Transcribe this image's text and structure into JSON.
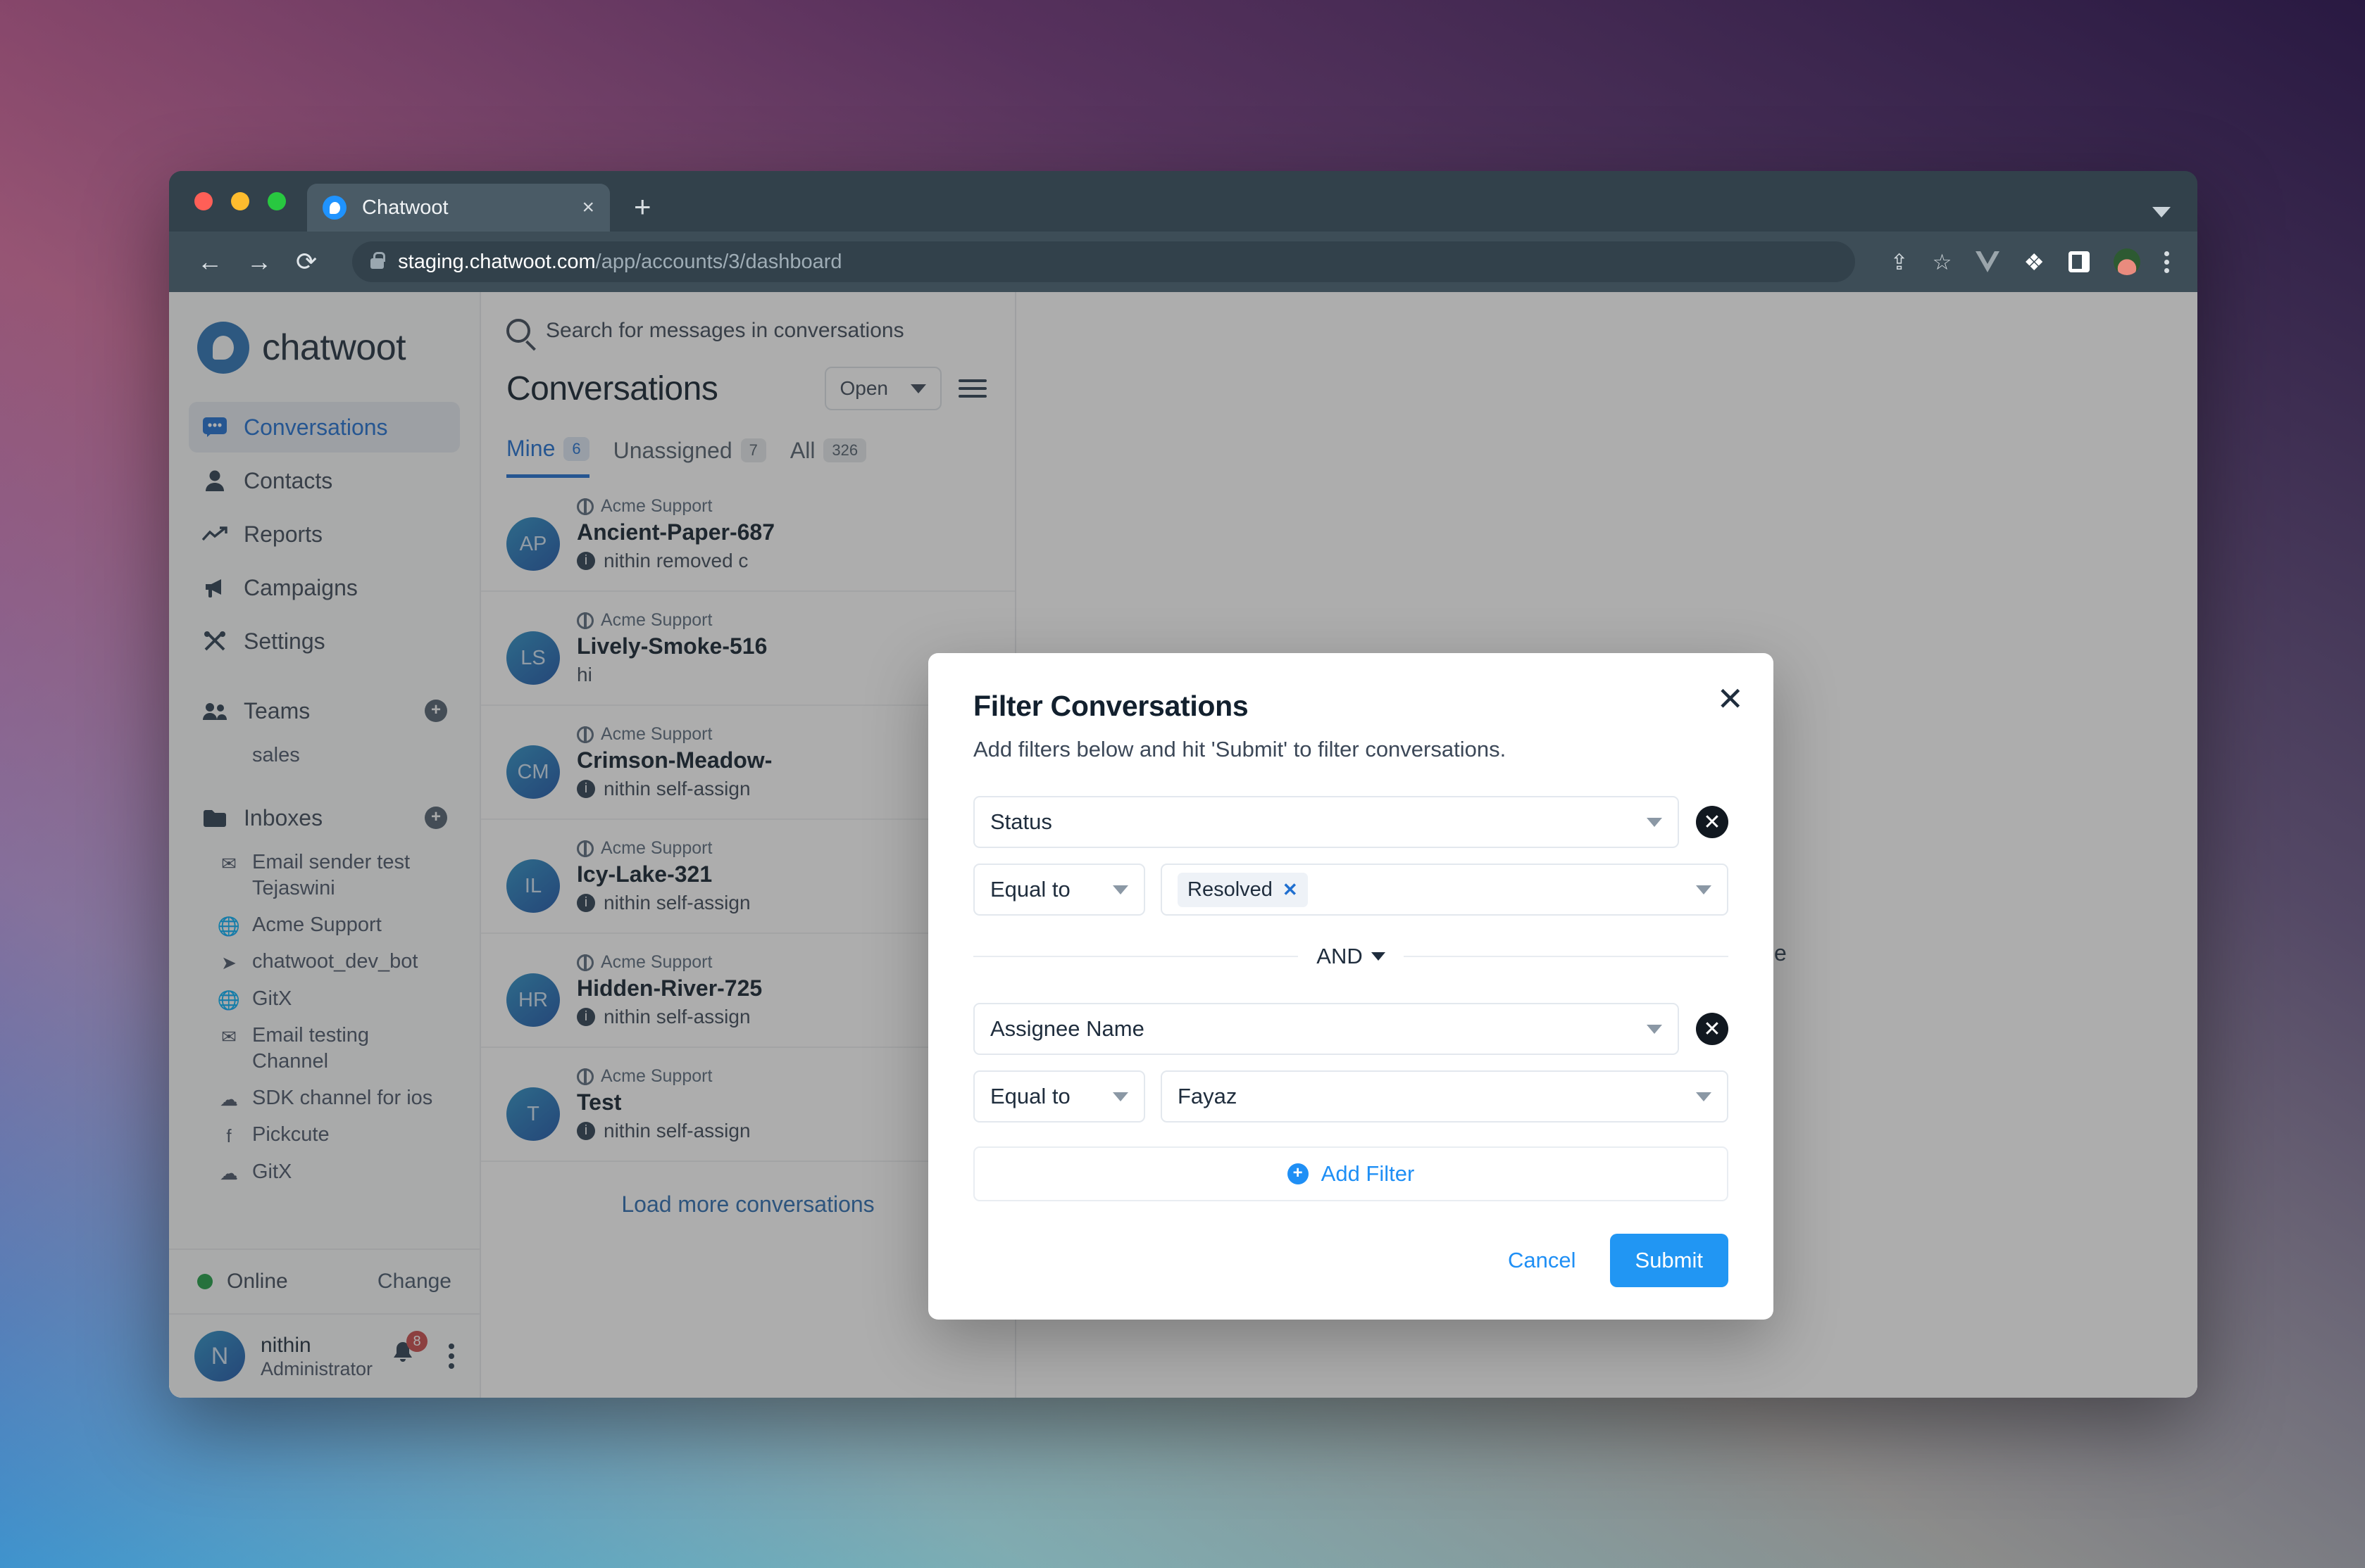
{
  "browser": {
    "tab": {
      "title": "Chatwoot",
      "close_label": "×",
      "favicon_name": "chatwoot-favicon"
    },
    "new_tab_label": "+",
    "url_host": "staging.chatwoot.com",
    "url_path": "/app/accounts/3/dashboard",
    "back_label": "←",
    "forward_label": "→",
    "reload_label": "⟳",
    "share_label": "⇪",
    "bookmark_label": "☆",
    "extensions_label": "❖",
    "menu_label": "kebab"
  },
  "sidebar": {
    "logo_text": "chatwoot",
    "nav": [
      {
        "label": "Conversations",
        "icon": "chat-bubble-icon",
        "glyph": "💬",
        "active": true
      },
      {
        "label": "Contacts",
        "icon": "person-icon",
        "glyph": "👤",
        "active": false
      },
      {
        "label": "Reports",
        "icon": "trending-up-icon",
        "glyph": "↗",
        "active": false
      },
      {
        "label": "Campaigns",
        "icon": "megaphone-icon",
        "glyph": "📣",
        "active": false
      },
      {
        "label": "Settings",
        "icon": "tools-icon",
        "glyph": "⚒",
        "active": false
      }
    ],
    "teams": {
      "label": "Teams",
      "icon": "people-icon",
      "glyph": "👥",
      "add_label": "+",
      "items": [
        {
          "label": "sales"
        }
      ]
    },
    "inboxes": {
      "label": "Inboxes",
      "icon": "folder-icon",
      "glyph": "🗀",
      "add_label": "+",
      "items": [
        {
          "label": "Email sender test Tejaswini",
          "icon": "envelope-icon",
          "glyph": "✉"
        },
        {
          "label": "Acme Support",
          "icon": "globe-icon",
          "glyph": "🌐"
        },
        {
          "label": "chatwoot_dev_bot",
          "icon": "telegram-icon",
          "glyph": "➤"
        },
        {
          "label": "GitX",
          "icon": "globe-icon",
          "glyph": "🌐"
        },
        {
          "label": "Email testing Channel",
          "icon": "envelope-icon",
          "glyph": "✉"
        },
        {
          "label": "SDK channel for ios",
          "icon": "cloud-icon",
          "glyph": "☁"
        },
        {
          "label": "Pickcute",
          "icon": "facebook-icon",
          "glyph": "f"
        },
        {
          "label": "GitX",
          "icon": "cloud-icon",
          "glyph": "☁"
        }
      ]
    },
    "status": {
      "label": "Online",
      "change_label": "Change",
      "color": "#1f9d45"
    },
    "profile": {
      "initial": "N",
      "name": "nithin",
      "role": "Administrator",
      "notification_count": "8",
      "bell_icon": "bell-icon",
      "menu_icon": "kebab-icon"
    }
  },
  "conversations": {
    "search_placeholder": "Search for messages in conversations",
    "title": "Conversations",
    "status_filter": "Open",
    "filter_icon": "sliders-icon",
    "tabs": [
      {
        "label": "Mine",
        "count": "6",
        "active": true
      },
      {
        "label": "Unassigned",
        "count": "7",
        "active": false
      },
      {
        "label": "All",
        "count": "326",
        "active": false
      }
    ],
    "items": [
      {
        "initials": "AP",
        "inbox": "Acme Support",
        "name": "Ancient-Paper-687",
        "message": "nithin removed c"
      },
      {
        "initials": "LS",
        "inbox": "Acme Support",
        "name": "Lively-Smoke-516",
        "message": "hi"
      },
      {
        "initials": "CM",
        "inbox": "Acme Support",
        "name": "Crimson-Meadow-",
        "message": "nithin self-assign"
      },
      {
        "initials": "IL",
        "inbox": "Acme Support",
        "name": "Icy-Lake-321",
        "message": "nithin self-assign"
      },
      {
        "initials": "HR",
        "inbox": "Acme Support",
        "name": "Hidden-River-725",
        "message": "nithin self-assign"
      },
      {
        "initials": "T",
        "inbox": "Acme Support",
        "name": "Test",
        "message": "nithin self-assign"
      }
    ],
    "load_more": "Load more conversations"
  },
  "empty_state": {
    "text": "Select a conversation from left pane"
  },
  "modal": {
    "title": "Filter Conversations",
    "subtitle": "Add filters below and hit 'Submit' to filter conversations.",
    "close_label": "✕",
    "remove_label": "✕",
    "groups": [
      {
        "attribute": "Status",
        "operator": "Equal to",
        "value_chip": "Resolved",
        "chip_remove": "✕",
        "value_text": null
      },
      {
        "attribute": "Assignee Name",
        "operator": "Equal to",
        "value_chip": null,
        "chip_remove": null,
        "value_text": "Fayaz"
      }
    ],
    "conjunction": "AND",
    "add_filter": "Add Filter",
    "add_filter_icon": "plus-circle-icon",
    "cancel": "Cancel",
    "submit": "Submit",
    "accent_color": "#2196f3"
  }
}
